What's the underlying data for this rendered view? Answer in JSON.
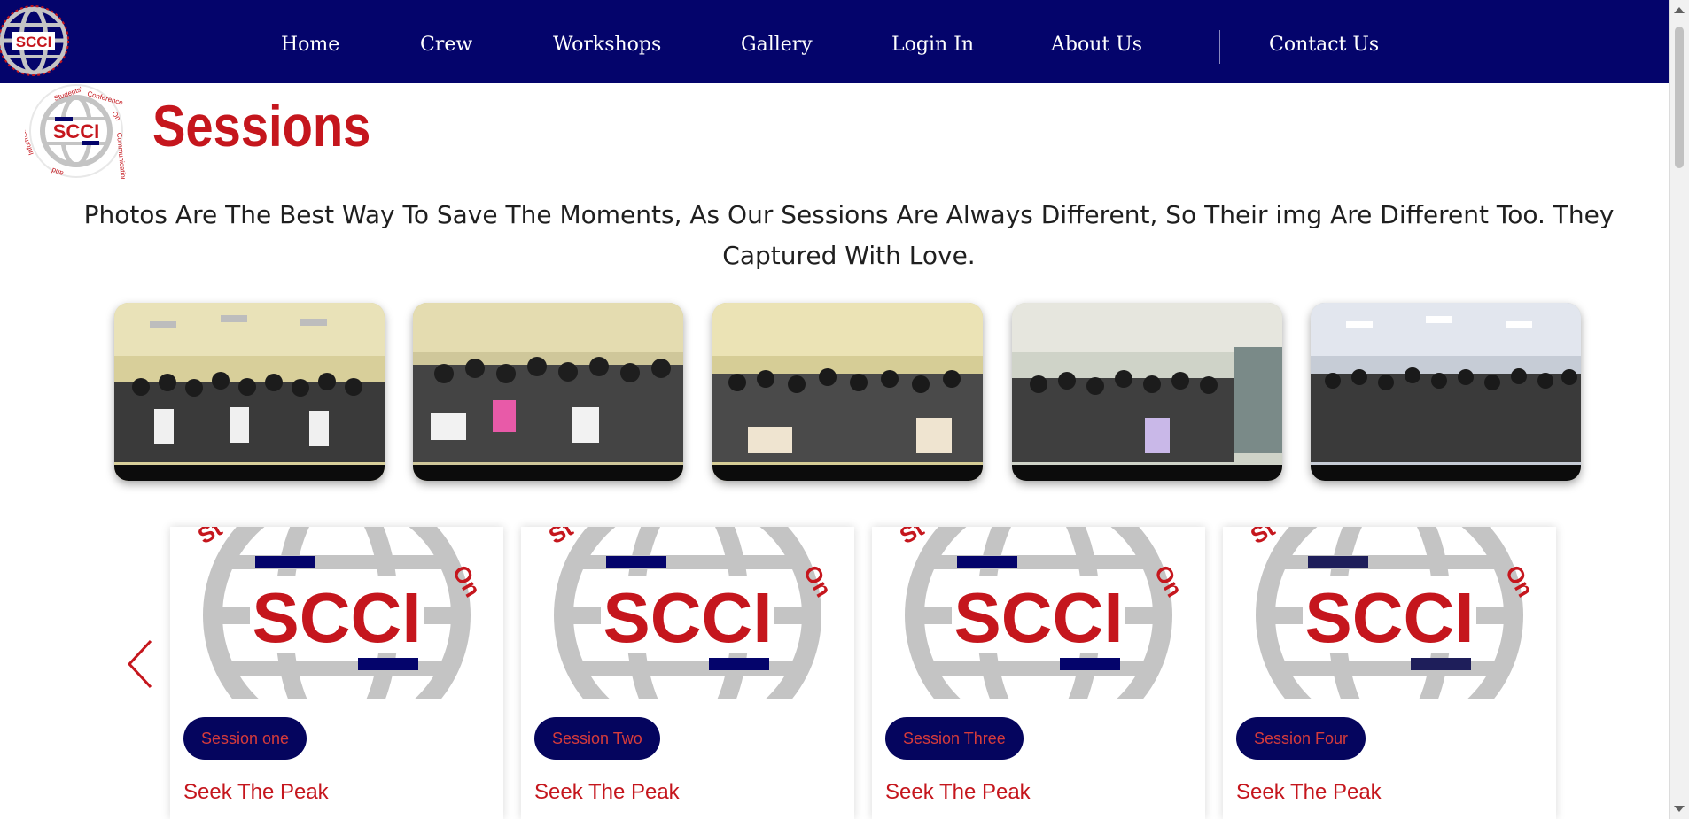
{
  "nav": {
    "links": [
      "Home",
      "Crew",
      "Workshops",
      "Gallery",
      "Login In",
      "About Us",
      "Contact Us"
    ]
  },
  "logo": {
    "text": "SCCI",
    "ring_words": [
      "Students'",
      "Conference",
      "On",
      "Communication",
      "and",
      "Information"
    ]
  },
  "section": {
    "title": "Sessions",
    "intro": "Photos Are The Best Way To Save The Moments, As Our Sessions Are Always Different, So Their img Are Different Too. They Captured With Love."
  },
  "gallery": {
    "photo_count": 5
  },
  "cards": [
    {
      "badge": "Session one",
      "title": "Seek The Peak"
    },
    {
      "badge": "Session Two",
      "title": "Seek The Peak"
    },
    {
      "badge": "Session Three",
      "title": "Seek The Peak"
    },
    {
      "badge": "Session Four",
      "title": "Seek The Peak"
    }
  ],
  "colors": {
    "nav_bg": "#04046b",
    "brand_red": "#c5161d",
    "badge_bg": "#05055e",
    "globe_gray": "#c4c4c4"
  },
  "icons": {
    "prev": "chevron-left-icon"
  }
}
